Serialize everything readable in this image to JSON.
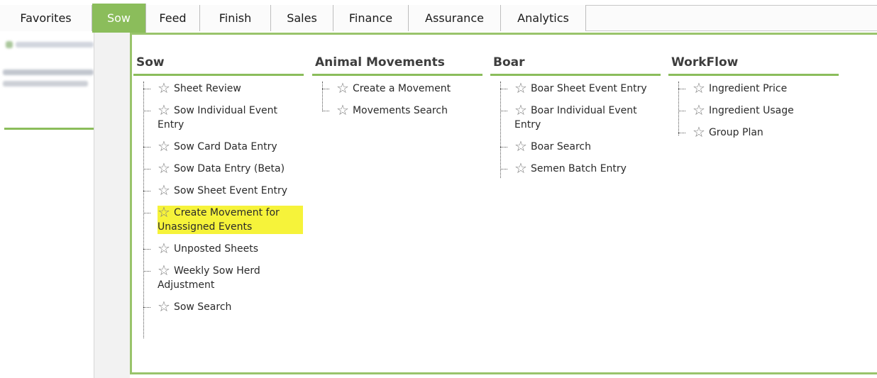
{
  "topnav": {
    "tabs": [
      {
        "label": "Favorites",
        "active": false
      },
      {
        "label": "Sow",
        "active": true
      },
      {
        "label": "Feed",
        "active": false
      },
      {
        "label": "Finish",
        "active": false
      },
      {
        "label": "Sales",
        "active": false
      },
      {
        "label": "Finance",
        "active": false
      },
      {
        "label": "Assurance",
        "active": false
      },
      {
        "label": "Analytics",
        "active": false
      }
    ]
  },
  "menu": {
    "columns": [
      {
        "heading": "Sow",
        "items": [
          {
            "label": "Sheet Review"
          },
          {
            "label": "Sow Individual Event Entry"
          },
          {
            "label": "Sow Card Data Entry"
          },
          {
            "label": "Sow Data Entry (Beta)"
          },
          {
            "label": "Sow Sheet Event Entry"
          },
          {
            "label": "Create Movement for Unassigned Events",
            "highlighted": true
          },
          {
            "label": "Unposted Sheets"
          },
          {
            "label": "Weekly Sow Herd Adjustment"
          },
          {
            "label": "Sow Search"
          }
        ]
      },
      {
        "heading": "Animal Movements",
        "items": [
          {
            "label": "Create a Movement"
          },
          {
            "label": "Movements Search"
          }
        ]
      },
      {
        "heading": "Boar",
        "items": [
          {
            "label": "Boar Sheet Event Entry"
          },
          {
            "label": "Boar Individual Event Entry"
          },
          {
            "label": "Boar Search"
          },
          {
            "label": "Semen Batch Entry"
          }
        ]
      },
      {
        "heading": "WorkFlow",
        "items": [
          {
            "label": "Ingredient Price"
          },
          {
            "label": "Ingredient Usage"
          },
          {
            "label": "Group Plan"
          }
        ]
      }
    ]
  },
  "icons": {
    "favorite": "star-outline-icon"
  },
  "colors": {
    "accent_green": "#8bbd5b",
    "panel_border": "#99c46b",
    "highlight": "#f6f33a"
  }
}
